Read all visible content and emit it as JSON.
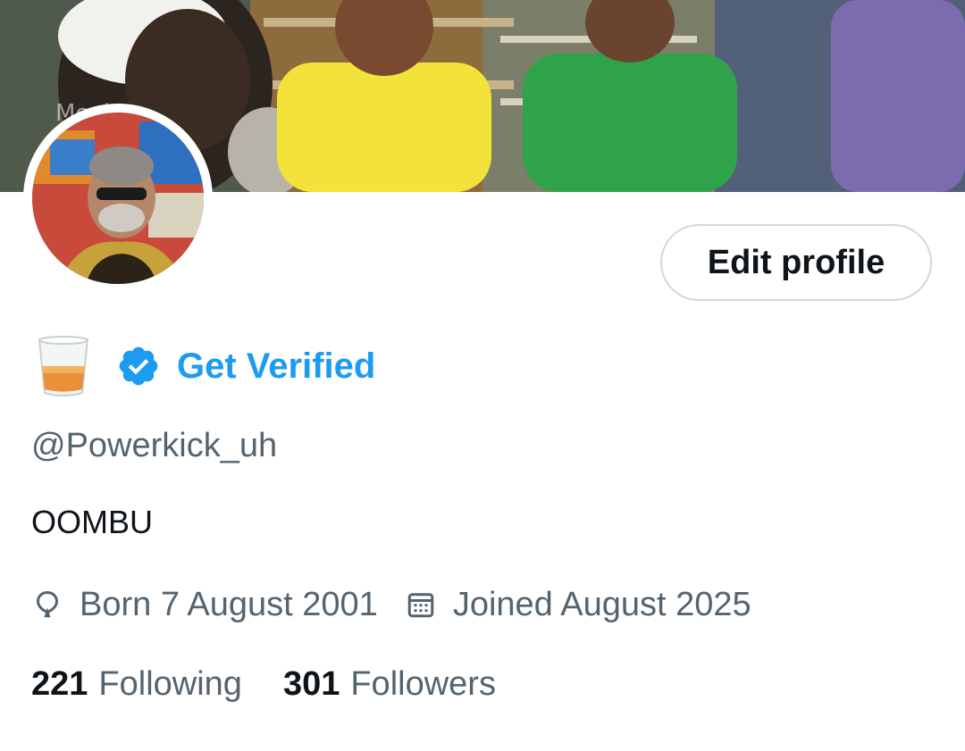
{
  "banner": {
    "watermark": "Movies"
  },
  "profile": {
    "edit_button_label": "Edit profile",
    "name_emoji": "tumbler-glass-icon",
    "get_verified_label": "Get Verified",
    "handle": "@Powerkick_uh",
    "bio": "OOMBU",
    "born": "Born 7 August 2001",
    "joined": "Joined August 2025",
    "following_count": "221",
    "following_label": "Following",
    "followers_count": "301",
    "followers_label": "Followers"
  },
  "colors": {
    "accent": "#1d9bf0",
    "primary_text": "#0f1419",
    "secondary_text": "#536471",
    "border": "#cfd9de"
  }
}
